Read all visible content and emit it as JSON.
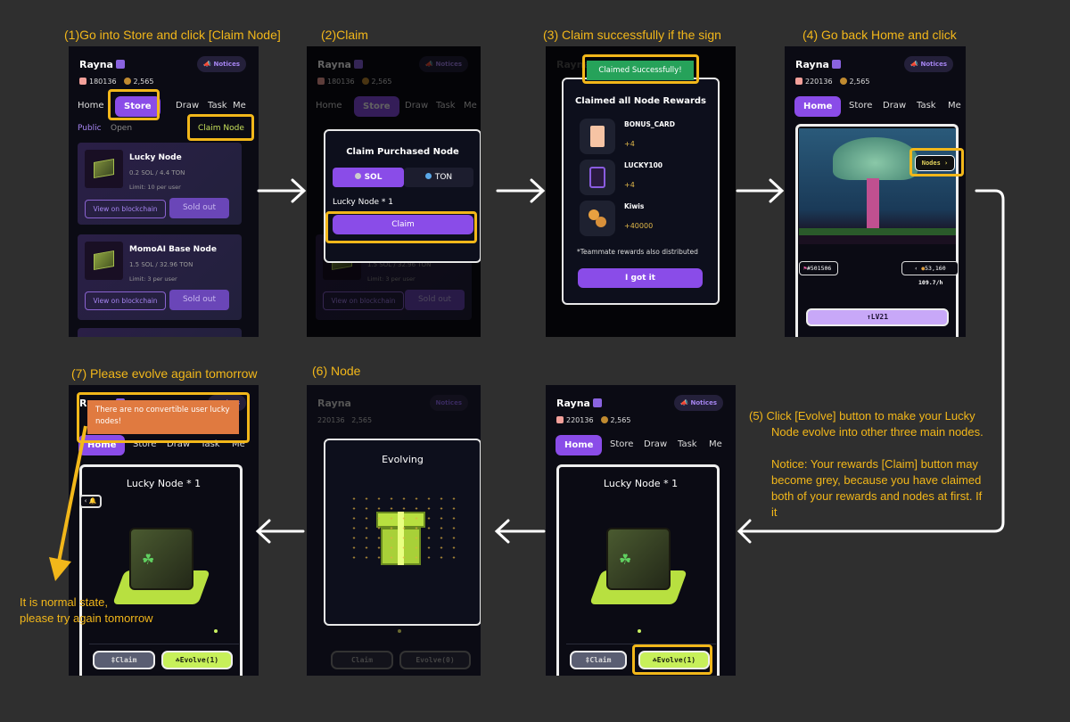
{
  "steps": {
    "s1": "(1)Go into Store and click [Claim Node]",
    "s2": "(2)Claim",
    "s3": "(3) Claim successfully if the sign",
    "s4": "(4) Go back Home and click",
    "s5_lines": [
      "(5) Click [Evolve] button to make your Lucky",
      "Node evolve into other three main nodes."
    ],
    "s5_notice_lines": [
      "Notice: Your rewards [Claim] button may",
      "become grey, because you have claimed",
      "both of your rewards and nodes at first. If",
      "it"
    ],
    "s6": "(6) Node",
    "s7": "(7) Please evolve again tomorrow",
    "s7_note_lines": [
      "It is normal state,",
      "please try again tomorrow"
    ]
  },
  "app": {
    "user": "Rayna",
    "notices_label": "Notices",
    "points_a": "180136",
    "points_b": "220136",
    "coins": "2,565",
    "nav": [
      "Home",
      "Store",
      "Draw",
      "Task",
      "Me"
    ]
  },
  "store": {
    "tab_public": "Public",
    "tab_open": "Open",
    "claim_node_label": "Claim Node",
    "items": [
      {
        "title": "Lucky Node",
        "price": "0.2 SOL / 4.4 TON",
        "limit": "Limit: 10 per user",
        "view": "View on blockchain",
        "status": "Sold out"
      },
      {
        "title": "MomoAI Base Node",
        "price": "1.5 SOL / 32.96 TON",
        "limit": "Limit: 3 per user",
        "view": "View on blockchain",
        "status": "Sold out"
      }
    ]
  },
  "claim_modal": {
    "title": "Claim Purchased Node",
    "opt_sol": "SOL",
    "opt_ton": "TON",
    "item": "Lucky Node * 1",
    "button": "Claim"
  },
  "success": {
    "toast": "Claimed Successfully!",
    "title": "Claimed all Node Rewards",
    "rewards": [
      {
        "name": "BONUS_CARD",
        "value": "+4"
      },
      {
        "name": "LUCKY100",
        "value": "+4"
      },
      {
        "name": "Kiwis",
        "value": "+40000"
      }
    ],
    "footnote": "*Teammate rewards also distributed",
    "button": "I got it"
  },
  "home": {
    "nodes_label": "Nodes",
    "rank": "#501506",
    "balance": "53,160",
    "rate": "109.7/h",
    "level_label": "LV21"
  },
  "node_view": {
    "title": "Lucky Node * 1",
    "claim_label": "Claim",
    "evolve_label": "Evolve(1)",
    "evolve_zero_label": "Evolve(0)"
  },
  "evolving": {
    "title": "Evolving"
  },
  "error_toast": "There are no convertible user lucky nodes!"
}
